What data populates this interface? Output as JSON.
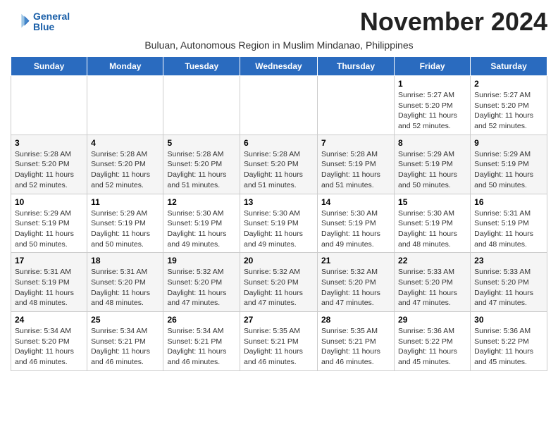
{
  "header": {
    "logo_line1": "General",
    "logo_line2": "Blue",
    "month_title": "November 2024",
    "subtitle": "Buluan, Autonomous Region in Muslim Mindanao, Philippines"
  },
  "days_of_week": [
    "Sunday",
    "Monday",
    "Tuesday",
    "Wednesday",
    "Thursday",
    "Friday",
    "Saturday"
  ],
  "weeks": [
    [
      {
        "day": "",
        "info": ""
      },
      {
        "day": "",
        "info": ""
      },
      {
        "day": "",
        "info": ""
      },
      {
        "day": "",
        "info": ""
      },
      {
        "day": "",
        "info": ""
      },
      {
        "day": "1",
        "info": "Sunrise: 5:27 AM\nSunset: 5:20 PM\nDaylight: 11 hours\nand 52 minutes."
      },
      {
        "day": "2",
        "info": "Sunrise: 5:27 AM\nSunset: 5:20 PM\nDaylight: 11 hours\nand 52 minutes."
      }
    ],
    [
      {
        "day": "3",
        "info": "Sunrise: 5:28 AM\nSunset: 5:20 PM\nDaylight: 11 hours\nand 52 minutes."
      },
      {
        "day": "4",
        "info": "Sunrise: 5:28 AM\nSunset: 5:20 PM\nDaylight: 11 hours\nand 52 minutes."
      },
      {
        "day": "5",
        "info": "Sunrise: 5:28 AM\nSunset: 5:20 PM\nDaylight: 11 hours\nand 51 minutes."
      },
      {
        "day": "6",
        "info": "Sunrise: 5:28 AM\nSunset: 5:20 PM\nDaylight: 11 hours\nand 51 minutes."
      },
      {
        "day": "7",
        "info": "Sunrise: 5:28 AM\nSunset: 5:19 PM\nDaylight: 11 hours\nand 51 minutes."
      },
      {
        "day": "8",
        "info": "Sunrise: 5:29 AM\nSunset: 5:19 PM\nDaylight: 11 hours\nand 50 minutes."
      },
      {
        "day": "9",
        "info": "Sunrise: 5:29 AM\nSunset: 5:19 PM\nDaylight: 11 hours\nand 50 minutes."
      }
    ],
    [
      {
        "day": "10",
        "info": "Sunrise: 5:29 AM\nSunset: 5:19 PM\nDaylight: 11 hours\nand 50 minutes."
      },
      {
        "day": "11",
        "info": "Sunrise: 5:29 AM\nSunset: 5:19 PM\nDaylight: 11 hours\nand 50 minutes."
      },
      {
        "day": "12",
        "info": "Sunrise: 5:30 AM\nSunset: 5:19 PM\nDaylight: 11 hours\nand 49 minutes."
      },
      {
        "day": "13",
        "info": "Sunrise: 5:30 AM\nSunset: 5:19 PM\nDaylight: 11 hours\nand 49 minutes."
      },
      {
        "day": "14",
        "info": "Sunrise: 5:30 AM\nSunset: 5:19 PM\nDaylight: 11 hours\nand 49 minutes."
      },
      {
        "day": "15",
        "info": "Sunrise: 5:30 AM\nSunset: 5:19 PM\nDaylight: 11 hours\nand 48 minutes."
      },
      {
        "day": "16",
        "info": "Sunrise: 5:31 AM\nSunset: 5:19 PM\nDaylight: 11 hours\nand 48 minutes."
      }
    ],
    [
      {
        "day": "17",
        "info": "Sunrise: 5:31 AM\nSunset: 5:19 PM\nDaylight: 11 hours\nand 48 minutes."
      },
      {
        "day": "18",
        "info": "Sunrise: 5:31 AM\nSunset: 5:20 PM\nDaylight: 11 hours\nand 48 minutes."
      },
      {
        "day": "19",
        "info": "Sunrise: 5:32 AM\nSunset: 5:20 PM\nDaylight: 11 hours\nand 47 minutes."
      },
      {
        "day": "20",
        "info": "Sunrise: 5:32 AM\nSunset: 5:20 PM\nDaylight: 11 hours\nand 47 minutes."
      },
      {
        "day": "21",
        "info": "Sunrise: 5:32 AM\nSunset: 5:20 PM\nDaylight: 11 hours\nand 47 minutes."
      },
      {
        "day": "22",
        "info": "Sunrise: 5:33 AM\nSunset: 5:20 PM\nDaylight: 11 hours\nand 47 minutes."
      },
      {
        "day": "23",
        "info": "Sunrise: 5:33 AM\nSunset: 5:20 PM\nDaylight: 11 hours\nand 47 minutes."
      }
    ],
    [
      {
        "day": "24",
        "info": "Sunrise: 5:34 AM\nSunset: 5:20 PM\nDaylight: 11 hours\nand 46 minutes."
      },
      {
        "day": "25",
        "info": "Sunrise: 5:34 AM\nSunset: 5:21 PM\nDaylight: 11 hours\nand 46 minutes."
      },
      {
        "day": "26",
        "info": "Sunrise: 5:34 AM\nSunset: 5:21 PM\nDaylight: 11 hours\nand 46 minutes."
      },
      {
        "day": "27",
        "info": "Sunrise: 5:35 AM\nSunset: 5:21 PM\nDaylight: 11 hours\nand 46 minutes."
      },
      {
        "day": "28",
        "info": "Sunrise: 5:35 AM\nSunset: 5:21 PM\nDaylight: 11 hours\nand 46 minutes."
      },
      {
        "day": "29",
        "info": "Sunrise: 5:36 AM\nSunset: 5:22 PM\nDaylight: 11 hours\nand 45 minutes."
      },
      {
        "day": "30",
        "info": "Sunrise: 5:36 AM\nSunset: 5:22 PM\nDaylight: 11 hours\nand 45 minutes."
      }
    ]
  ]
}
